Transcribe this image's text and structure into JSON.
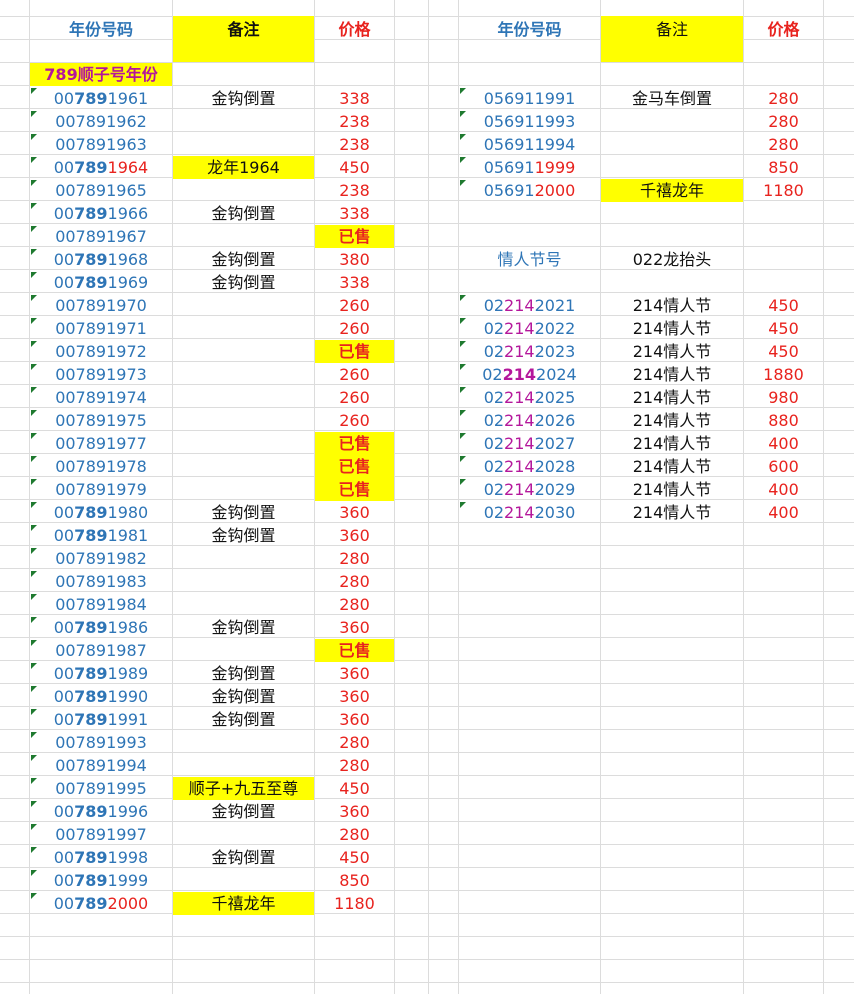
{
  "colors": {
    "number_blue": "#2e75b6",
    "price_red": "#e8231e",
    "highlight_yellow": "#ffff00",
    "magenta": "#b4179b",
    "marker_green": "#1f7a30"
  },
  "left": {
    "headers": {
      "number": "年份号码",
      "note": "备注",
      "price": "价格"
    },
    "section_title": "789顺子号年份",
    "rows": [
      {
        "parts": [
          {
            "t": "00"
          },
          {
            "t": "789",
            "s": "b"
          },
          {
            "t": "1961"
          }
        ],
        "note": "金钩倒置",
        "price": "338"
      },
      {
        "parts": [
          {
            "t": "007891962"
          }
        ],
        "note": "",
        "price": "238"
      },
      {
        "parts": [
          {
            "t": "007891963"
          }
        ],
        "note": "",
        "price": "238"
      },
      {
        "parts": [
          {
            "t": "00"
          },
          {
            "t": "789",
            "s": "b"
          },
          {
            "t": "1964",
            "s": "r"
          }
        ],
        "note": "龙年1964",
        "note_hl": true,
        "price": "450"
      },
      {
        "parts": [
          {
            "t": "007891965"
          }
        ],
        "note": "",
        "price": "238"
      },
      {
        "parts": [
          {
            "t": "00"
          },
          {
            "t": "789",
            "s": "b"
          },
          {
            "t": "1966"
          }
        ],
        "note": "金钩倒置",
        "price": "338"
      },
      {
        "parts": [
          {
            "t": "007891967"
          }
        ],
        "note": "",
        "price": "已售",
        "sold": true
      },
      {
        "parts": [
          {
            "t": "00"
          },
          {
            "t": "789",
            "s": "b"
          },
          {
            "t": "1968"
          }
        ],
        "note": "金钩倒置",
        "price": "380"
      },
      {
        "parts": [
          {
            "t": "00"
          },
          {
            "t": "789",
            "s": "b"
          },
          {
            "t": "1969"
          }
        ],
        "note": "金钩倒置",
        "price": "338"
      },
      {
        "parts": [
          {
            "t": "007891970"
          }
        ],
        "note": "",
        "price": "260"
      },
      {
        "parts": [
          {
            "t": "007891971"
          }
        ],
        "note": "",
        "price": "260"
      },
      {
        "parts": [
          {
            "t": "007891972"
          }
        ],
        "note": "",
        "price": "已售",
        "sold": true
      },
      {
        "parts": [
          {
            "t": "007891973"
          }
        ],
        "note": "",
        "price": "260"
      },
      {
        "parts": [
          {
            "t": "007891974"
          }
        ],
        "note": "",
        "price": "260"
      },
      {
        "parts": [
          {
            "t": "007891975"
          }
        ],
        "note": "",
        "price": "260"
      },
      {
        "parts": [
          {
            "t": "007891977"
          }
        ],
        "note": "",
        "price": "已售",
        "sold": true
      },
      {
        "parts": [
          {
            "t": "007891978"
          }
        ],
        "note": "",
        "price": "已售",
        "sold": true
      },
      {
        "parts": [
          {
            "t": "007891979"
          }
        ],
        "note": "",
        "price": "已售",
        "sold": true
      },
      {
        "parts": [
          {
            "t": "00"
          },
          {
            "t": "789",
            "s": "b"
          },
          {
            "t": "1980"
          }
        ],
        "note": "金钩倒置",
        "price": "360"
      },
      {
        "parts": [
          {
            "t": "00"
          },
          {
            "t": "789",
            "s": "b"
          },
          {
            "t": "1981"
          }
        ],
        "note": "金钩倒置",
        "price": "360"
      },
      {
        "parts": [
          {
            "t": "007891982"
          }
        ],
        "note": "",
        "price": "280"
      },
      {
        "parts": [
          {
            "t": "007891983"
          }
        ],
        "note": "",
        "price": "280"
      },
      {
        "parts": [
          {
            "t": "007891984"
          }
        ],
        "note": "",
        "price": "280"
      },
      {
        "parts": [
          {
            "t": "00"
          },
          {
            "t": "789",
            "s": "b"
          },
          {
            "t": "1986"
          }
        ],
        "note": "金钩倒置",
        "price": "360"
      },
      {
        "parts": [
          {
            "t": "007891987"
          }
        ],
        "note": "",
        "price": "已售",
        "sold": true
      },
      {
        "parts": [
          {
            "t": "00"
          },
          {
            "t": "789",
            "s": "b"
          },
          {
            "t": "1989"
          }
        ],
        "note": "金钩倒置",
        "price": "360"
      },
      {
        "parts": [
          {
            "t": "00"
          },
          {
            "t": "789",
            "s": "b"
          },
          {
            "t": "1990"
          }
        ],
        "note": "金钩倒置",
        "price": "360"
      },
      {
        "parts": [
          {
            "t": "00"
          },
          {
            "t": "789",
            "s": "b"
          },
          {
            "t": "1991"
          }
        ],
        "note": "金钩倒置",
        "price": "360"
      },
      {
        "parts": [
          {
            "t": "007891993"
          }
        ],
        "note": "",
        "price": "280"
      },
      {
        "parts": [
          {
            "t": "007891994"
          }
        ],
        "note": "",
        "price": "280"
      },
      {
        "parts": [
          {
            "t": "007891995"
          }
        ],
        "note": "顺子+九五至尊",
        "note_hl": true,
        "price": "450"
      },
      {
        "parts": [
          {
            "t": "00"
          },
          {
            "t": "789",
            "s": "b"
          },
          {
            "t": "1996"
          }
        ],
        "note": "金钩倒置",
        "price": "360"
      },
      {
        "parts": [
          {
            "t": "007891997"
          }
        ],
        "note": "",
        "price": "280"
      },
      {
        "parts": [
          {
            "t": "00"
          },
          {
            "t": "789",
            "s": "b"
          },
          {
            "t": "1998"
          }
        ],
        "note": "金钩倒置",
        "price": "450"
      },
      {
        "parts": [
          {
            "t": "00"
          },
          {
            "t": "789",
            "s": "b"
          },
          {
            "t": "1999"
          }
        ],
        "note": "",
        "price": "850"
      },
      {
        "parts": [
          {
            "t": "00"
          },
          {
            "t": "789",
            "s": "b"
          },
          {
            "t": "2000",
            "s": "r"
          }
        ],
        "note": "千禧龙年",
        "note_hl": true,
        "price": "1180"
      }
    ]
  },
  "right": {
    "headers": {
      "number": "年份号码",
      "note": "备注",
      "price": "价格"
    },
    "rows_a": [
      {
        "parts": [
          {
            "t": "056911991"
          }
        ],
        "note": "金马车倒置",
        "price": "280"
      },
      {
        "parts": [
          {
            "t": "056911993"
          }
        ],
        "note": "",
        "price": "280"
      },
      {
        "parts": [
          {
            "t": "056911994"
          }
        ],
        "note": "",
        "price": "280"
      },
      {
        "parts": [
          {
            "t": "05691"
          },
          {
            "t": "1999",
            "s": "r"
          }
        ],
        "note": "",
        "price": "850"
      },
      {
        "parts": [
          {
            "t": "05691"
          },
          {
            "t": "2000",
            "s": "r"
          }
        ],
        "note": "千禧龙年",
        "note_hl": true,
        "price": "1180"
      }
    ],
    "section": {
      "label": "情人节号",
      "note": "022龙抬头"
    },
    "rows_b": [
      {
        "parts": [
          {
            "t": "02"
          },
          {
            "t": "214",
            "s": "m"
          },
          {
            "t": "2021"
          }
        ],
        "note": "214情人节",
        "price": "450"
      },
      {
        "parts": [
          {
            "t": "02"
          },
          {
            "t": "214",
            "s": "m"
          },
          {
            "t": "2022"
          }
        ],
        "note": "214情人节",
        "price": "450"
      },
      {
        "parts": [
          {
            "t": "02"
          },
          {
            "t": "214",
            "s": "m"
          },
          {
            "t": "2023"
          }
        ],
        "note": "214情人节",
        "price": "450"
      },
      {
        "parts": [
          {
            "t": "02"
          },
          {
            "t": "214",
            "s": "mb"
          },
          {
            "t": "2024"
          }
        ],
        "note": "214情人节",
        "price": "1880"
      },
      {
        "parts": [
          {
            "t": "02"
          },
          {
            "t": "214",
            "s": "m"
          },
          {
            "t": "2025"
          }
        ],
        "note": "214情人节",
        "price": "980"
      },
      {
        "parts": [
          {
            "t": "02"
          },
          {
            "t": "214",
            "s": "m"
          },
          {
            "t": "2026"
          }
        ],
        "note": "214情人节",
        "price": "880"
      },
      {
        "parts": [
          {
            "t": "02"
          },
          {
            "t": "214",
            "s": "m"
          },
          {
            "t": "2027"
          }
        ],
        "note": "214情人节",
        "price": "400"
      },
      {
        "parts": [
          {
            "t": "02"
          },
          {
            "t": "214",
            "s": "m"
          },
          {
            "t": "2028"
          }
        ],
        "note": "214情人节",
        "price": "600"
      },
      {
        "parts": [
          {
            "t": "02"
          },
          {
            "t": "214",
            "s": "m"
          },
          {
            "t": "2029"
          }
        ],
        "note": "214情人节",
        "price": "400"
      },
      {
        "parts": [
          {
            "t": "02"
          },
          {
            "t": "214",
            "s": "m"
          },
          {
            "t": "2030"
          }
        ],
        "note": "214情人节",
        "price": "400"
      }
    ]
  }
}
